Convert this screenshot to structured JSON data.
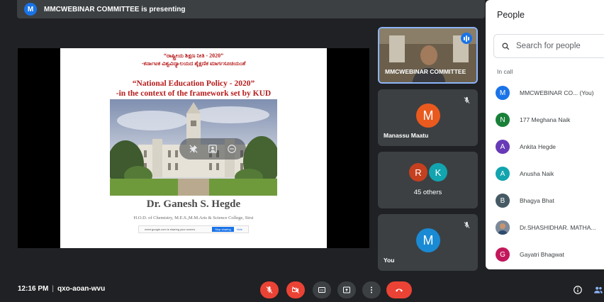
{
  "banner": {
    "avatar_letter": "M",
    "text": "MMCWEBINAR COMMITTEE is presenting"
  },
  "slide": {
    "kannada_line1": "“ರಾಷ್ಟ್ರೀಯ ಶಿಕ್ಷಣ ನೀತಿ - 2020”",
    "kannada_line2": "-ಕರ್ನಾಟಕ ವಿಶ್ವವಿದ್ಯಾಲಯದ ಶೈಕ್ಷಣಿಕ ಮಾರ್ಗಸೂಚಿಯಂತೆ",
    "title_line1": "“National Education Policy - 2020”",
    "title_line2": "-in the context of the framework set by KUD",
    "speaker": "Dr. Ganesh S. Hegde",
    "affiliation": "H.O.D. of Chemistry, M.E.S.,M.M.Arts & Science College, Sirsi",
    "share_text": "meet.google.com is sharing your screen.",
    "stop_sharing": "Stop sharing",
    "hide": "Hide"
  },
  "tiles": [
    {
      "name": "MMCWEBINAR COMMITTEE",
      "speaking": true
    },
    {
      "name": "Manassu Maatu",
      "avatar_letter": "M",
      "avatar_color": "#ea5a1e",
      "muted": true
    },
    {
      "others_label": "45 others",
      "avatars": [
        {
          "letter": "R",
          "color": "#c5401f"
        },
        {
          "letter": "K",
          "color": "#12a4af"
        }
      ]
    },
    {
      "name": "You",
      "avatar_letter": "M",
      "avatar_color": "#1a8ad4",
      "muted": true
    }
  ],
  "people_panel": {
    "title": "People",
    "search_placeholder": "Search for people",
    "section_label": "In call",
    "participants": [
      {
        "name": "MMCWEBINAR CO...  (You)",
        "letter": "M",
        "color": "#1a73e8"
      },
      {
        "name": "177 Meghana Naik",
        "letter": "N",
        "color": "#188038"
      },
      {
        "name": "Ankita Hegde",
        "letter": "A",
        "color": "#673ab7"
      },
      {
        "name": "Anusha Naik",
        "letter": "A",
        "color": "#12a4af"
      },
      {
        "name": "Bhagya Bhat",
        "letter": "B",
        "color": "#455a64"
      },
      {
        "name": "Dr.SHASHIDHAR. MATHA...",
        "letter": "",
        "color": "#8d6e63",
        "photo": true
      },
      {
        "name": "Gayatri Bhagwat",
        "letter": "G",
        "color": "#c2185b"
      }
    ]
  },
  "meeting": {
    "time": "12:16 PM",
    "code": "qxo-aoan-wvu"
  },
  "colors": {
    "end_call": "#ea4335",
    "accent": "#1a73e8",
    "control_bg": "#3c4043"
  }
}
